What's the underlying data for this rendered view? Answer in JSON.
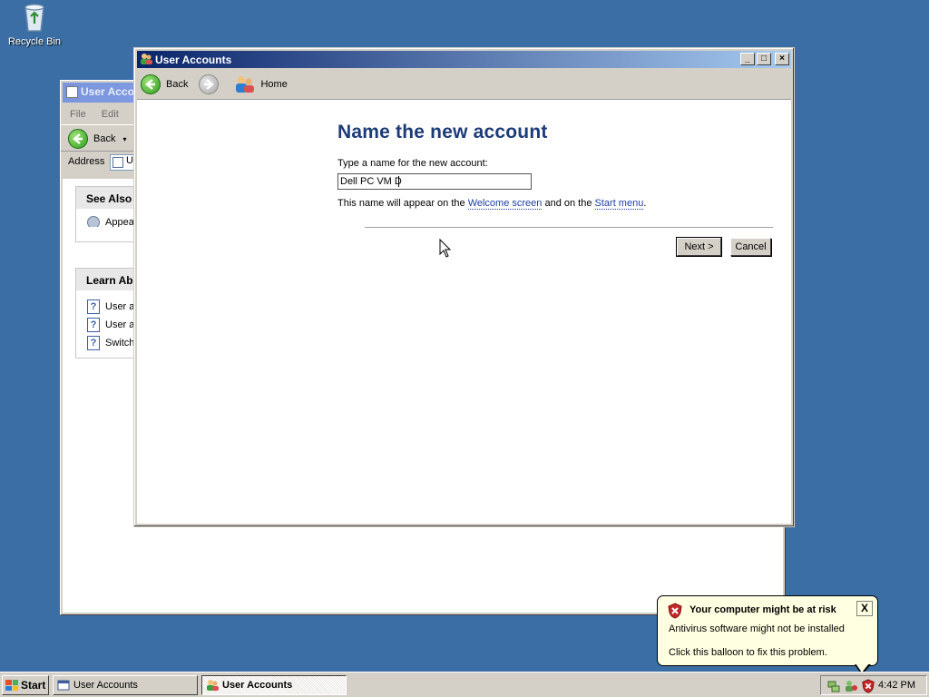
{
  "desktop": {
    "recycle_bin_label": "Recycle Bin"
  },
  "back_window": {
    "title": "User Acco",
    "menu": [
      "File",
      "Edit"
    ],
    "back_label": "Back",
    "address_label": "Address",
    "address_value": "U",
    "see_also": {
      "title": "See Also",
      "items": [
        "Appea"
      ]
    },
    "learn_about": {
      "title": "Learn Abo",
      "items": [
        "User a",
        "User a",
        "Switch"
      ]
    }
  },
  "main_window": {
    "title": "User Accounts",
    "nav": {
      "back_label": "Back",
      "home_label": "Home"
    },
    "heading": "Name the new account",
    "prompt": "Type a name for the new account:",
    "name_value": "Dell PC VM D",
    "hint_prefix": "This name will appear on the ",
    "hint_link1": "Welcome screen",
    "hint_mid": " and on the ",
    "hint_link2": "Start menu",
    "hint_suffix": ".",
    "next_label": "Next >",
    "cancel_label": "Cancel"
  },
  "taskbar": {
    "start_label": "Start",
    "tasks": [
      "User Accounts",
      "User Accounts"
    ],
    "clock": "4:42 PM"
  },
  "balloon": {
    "title": "Your computer might be at risk",
    "line1": "Antivirus software might not be installed",
    "line2": "Click this balloon to fix this problem.",
    "close": "X"
  },
  "colors": {
    "desktop": "#3a6ea5",
    "title_active": "#0a246a",
    "heading": "#1c3b79",
    "link": "#1f3fa3",
    "balloon_bg": "#ffffe1"
  }
}
